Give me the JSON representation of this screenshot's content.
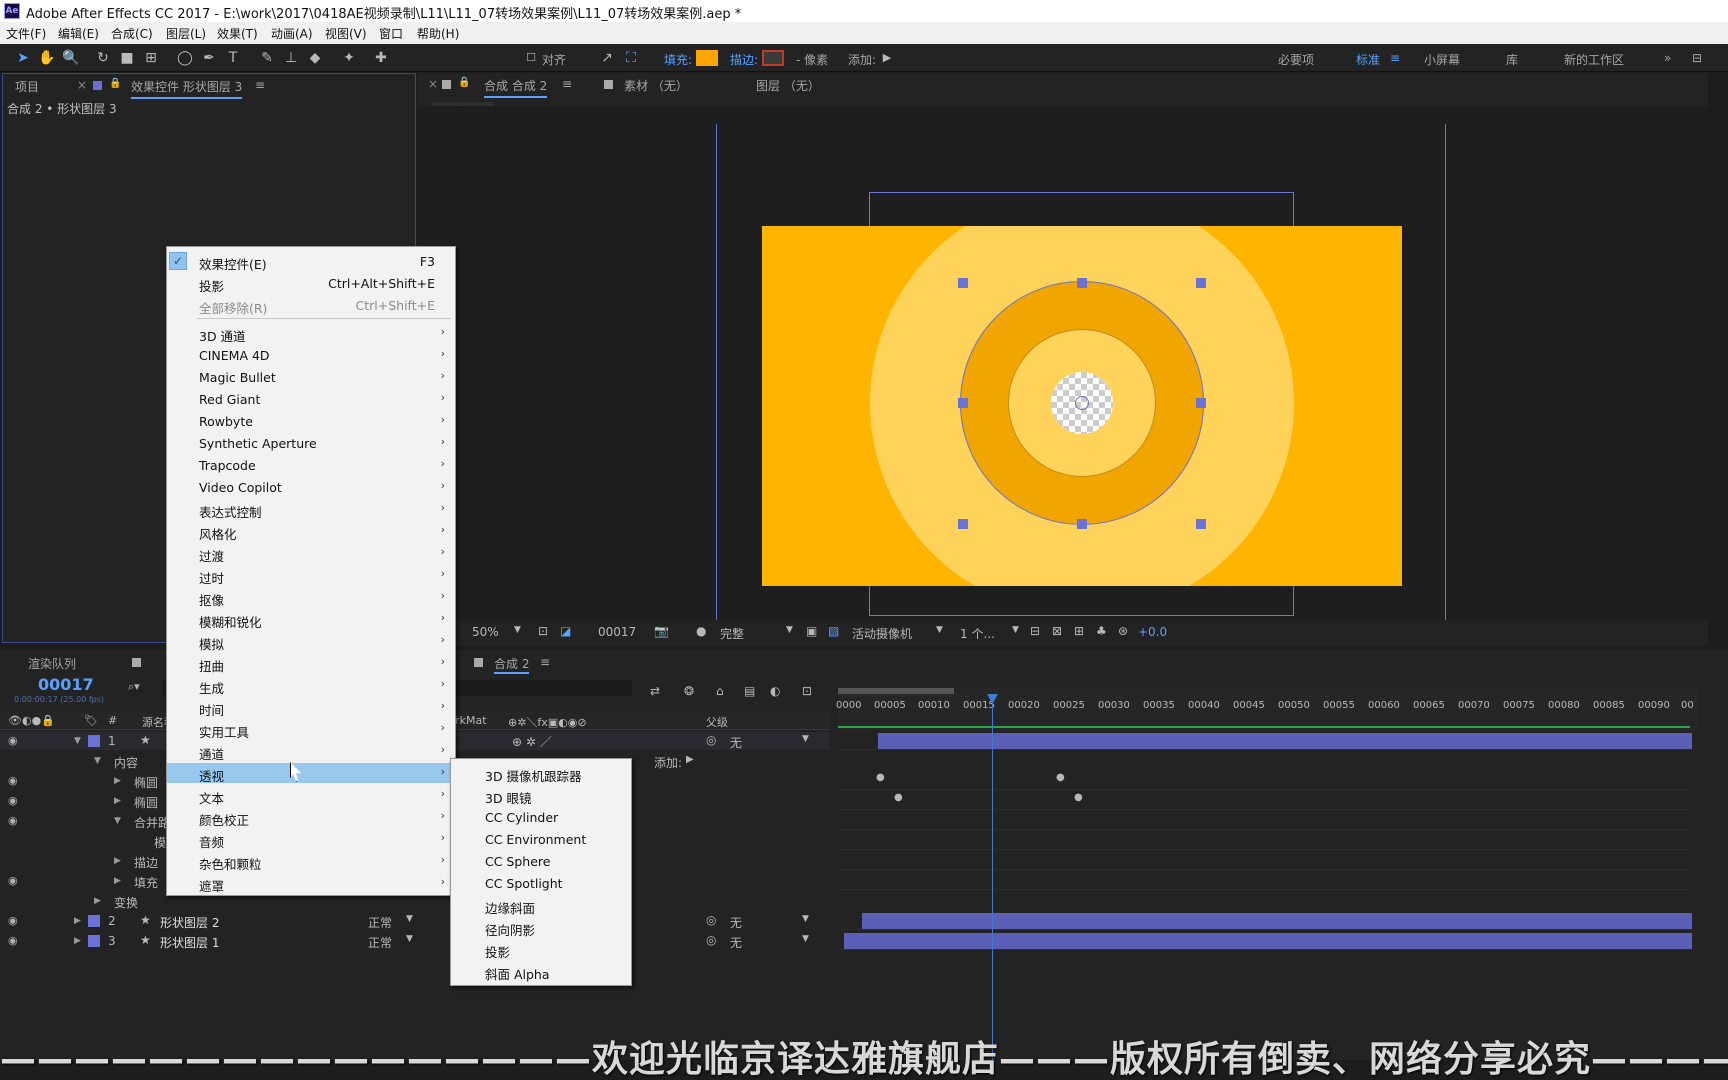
{
  "window": {
    "app_icon": "Ae",
    "title": "Adobe After Effects CC 2017 - E:\\work\\2017\\0418AE视频录制\\L11\\L11_07转场效果案例\\L11_07转场效果案例.aep *"
  },
  "menubar": [
    "文件(F)",
    "编辑(E)",
    "合成(C)",
    "图层(L)",
    "效果(T)",
    "动画(A)",
    "视图(V)",
    "窗口",
    "帮助(H)"
  ],
  "toolbar": {
    "align_label": "对齐",
    "fill_label": "填充:",
    "stroke_label": "描边:",
    "pixels_label": "- 像素",
    "add_label": "添加:",
    "fill_color": "#ffa500",
    "stroke_color": "#c0392b",
    "workspaces": [
      "必要项",
      "标准",
      "小屏幕",
      "库",
      "新的工作区"
    ],
    "active_workspace": "标准"
  },
  "left_panel": {
    "tab_project": "项目",
    "tab_effects": "效果控件 形状图层 3",
    "breadcrumb": "合成 2 • 形状图层 3"
  },
  "viewer": {
    "tab_comp": "合成 合成 2",
    "tab_footage": "素材 （无）",
    "tab_layer": "图层 （无）",
    "comp_chip": "合成 2",
    "zoom": "50%",
    "timecode": "00017",
    "quality": "完整",
    "camera": "活动摄像机",
    "views": "1 个...",
    "exposure": "+0.0",
    "bg_color": "#ffb400",
    "outer_circle_color": "#ffd35a",
    "ring_color": "#f0a500",
    "selection_color": "#6b72d6"
  },
  "effect_menu": {
    "items": [
      {
        "label": "效果控件(E)",
        "shortcut": "F3",
        "checked": true
      },
      {
        "label": "投影",
        "shortcut": "Ctrl+Alt+Shift+E"
      },
      {
        "label": "全部移除(R)",
        "shortcut": "Ctrl+Shift+E",
        "disabled": true
      },
      {
        "label": "3D 通道",
        "sub": true
      },
      {
        "label": "CINEMA 4D",
        "sub": true
      },
      {
        "label": "Magic Bullet",
        "sub": true
      },
      {
        "label": "Red Giant",
        "sub": true
      },
      {
        "label": "Rowbyte",
        "sub": true
      },
      {
        "label": "Synthetic Aperture",
        "sub": true
      },
      {
        "label": "Trapcode",
        "sub": true
      },
      {
        "label": "Video Copilot",
        "sub": true
      },
      {
        "label": "表达式控制",
        "sub": true
      },
      {
        "label": "风格化",
        "sub": true
      },
      {
        "label": "过渡",
        "sub": true
      },
      {
        "label": "过时",
        "sub": true
      },
      {
        "label": "抠像",
        "sub": true
      },
      {
        "label": "模糊和锐化",
        "sub": true
      },
      {
        "label": "模拟",
        "sub": true
      },
      {
        "label": "扭曲",
        "sub": true
      },
      {
        "label": "生成",
        "sub": true
      },
      {
        "label": "时间",
        "sub": true
      },
      {
        "label": "实用工具",
        "sub": true
      },
      {
        "label": "通道",
        "sub": true
      },
      {
        "label": "透视",
        "sub": true,
        "highlighted": true
      },
      {
        "label": "文本",
        "sub": true
      },
      {
        "label": "颜色校正",
        "sub": true
      },
      {
        "label": "音频",
        "sub": true
      },
      {
        "label": "杂色和颗粒",
        "sub": true
      },
      {
        "label": "遮罩",
        "sub": true
      }
    ]
  },
  "perspective_submenu": {
    "items": [
      "3D 摄像机跟踪器",
      "3D 眼镜",
      "CC Cylinder",
      "CC Environment",
      "CC Sphere",
      "CC Spotlight",
      "边缘斜面",
      "径向阴影",
      "投影",
      "斜面 Alpha"
    ]
  },
  "timeline": {
    "tab_render": "渲染队列",
    "tab_comp": "合成 2",
    "current_time": "00017",
    "time_sub": "0:00:00:17 (25.00 fps)",
    "col_number": "#",
    "col_source": "源名称",
    "col_trkmat": "TrkMat",
    "col_parent": "父级",
    "ruler": [
      "0000",
      "00005",
      "00010",
      "00015",
      "00020",
      "00025",
      "00030",
      "00035",
      "00040",
      "00045",
      "00050",
      "00055",
      "00060",
      "00065",
      "00070",
      "00075",
      "00080",
      "00085",
      "00090",
      "00"
    ],
    "layer1_num": "1",
    "layer1_parent": "无",
    "contents_label": "内容",
    "add_label": "添加:",
    "sub_rows": [
      "椭圆",
      "椭圆",
      "合并路",
      "模",
      "描边",
      "填充"
    ],
    "transform_label": "变换",
    "layers": [
      {
        "num": "2",
        "name": "形状图层 2",
        "mode": "正常",
        "parent": "无"
      },
      {
        "num": "3",
        "name": "形状图层 1",
        "mode": "正常",
        "parent": "无"
      }
    ]
  },
  "watermark": "————————————————欢迎光临京译达雅旗舰店———版权所有倒卖、网络分享必究———————————"
}
